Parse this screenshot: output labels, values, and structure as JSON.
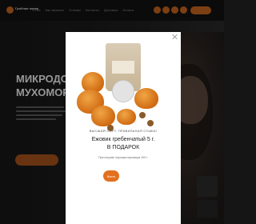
{
  "site": {
    "logo_text": "Грибная\nлавка",
    "nav": [
      "О нас",
      "Как заказать",
      "Отзывы",
      "Контакты",
      "Доставка",
      "Оплата"
    ],
    "hero_title": "МИКРОДО\nМУХОМОР",
    "accent_color": "#c8661f"
  },
  "modal": {
    "subhead": "ВЫСШИЙ СОРТ, ПРАВИЛЬНАЯ СУШКА!",
    "headline": "Ежовик гребенчатый 5 г.",
    "gift": "В ПОДАРОК",
    "small_print": "При покупке порошка мухомора 100 г.",
    "button_label": "Взять",
    "button_color": "#e2701f",
    "close_icon": "close-icon"
  }
}
